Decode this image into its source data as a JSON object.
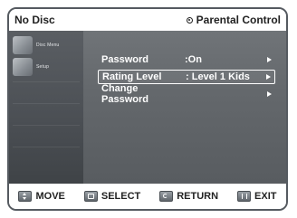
{
  "header": {
    "disc_status": "No Disc",
    "menu_title": "Parental Control"
  },
  "sidebar": {
    "items": [
      {
        "label": "Disc Menu",
        "icon": "disc-menu-icon"
      },
      {
        "label": "Setup",
        "icon": "setup-icon"
      }
    ]
  },
  "menu": {
    "items": [
      {
        "label": "Password",
        "value": ":On",
        "selected": false
      },
      {
        "label": "Rating Level",
        "value": ": Level 1 Kids",
        "selected": true
      },
      {
        "label": "Change Password",
        "value": "",
        "selected": false
      }
    ]
  },
  "footer": {
    "move_label": "MOVE",
    "select_label": "SELECT",
    "return_label": "RETURN",
    "exit_label": "EXIT"
  },
  "colors": {
    "side_panel": "#4c5055",
    "main_panel": "#64686c",
    "frame_border": "#555a60",
    "text_on_panel": "#ffffff"
  }
}
